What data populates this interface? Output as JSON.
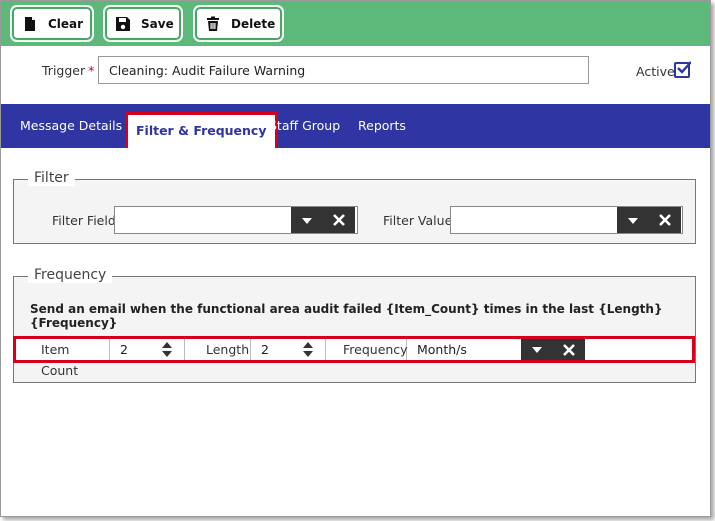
{
  "toolbar": {
    "clear_label": "Clear",
    "save_label": "Save",
    "delete_label": "Delete",
    "bg_color": "#5cb97a"
  },
  "trigger": {
    "label": "Trigger",
    "required_mark": "*",
    "value": "Cleaning: Audit Failure Warning"
  },
  "active": {
    "label": "Active",
    "checked": true
  },
  "tabs": [
    {
      "label": "Message Details",
      "active": false
    },
    {
      "label": "Filter & Frequency",
      "active": true
    },
    {
      "label": "Staff Group",
      "active": false
    },
    {
      "label": "Reports",
      "active": false
    }
  ],
  "filter": {
    "legend": "Filter",
    "field_label": "Filter Field",
    "field_value": "",
    "value_label": "Filter Value",
    "value_value": ""
  },
  "frequency": {
    "legend": "Frequency",
    "description": "Send an email when the functional area audit failed {Item_Count} times in the last {Length} {Frequency}",
    "item_count_label": "Item Count",
    "item_count_value": "2",
    "length_label": "Length",
    "length_value": "2",
    "frequency_label": "Frequency",
    "frequency_value": "Month/s"
  },
  "colors": {
    "tabbar": "#2f35a3",
    "highlight": "#d6001c"
  }
}
